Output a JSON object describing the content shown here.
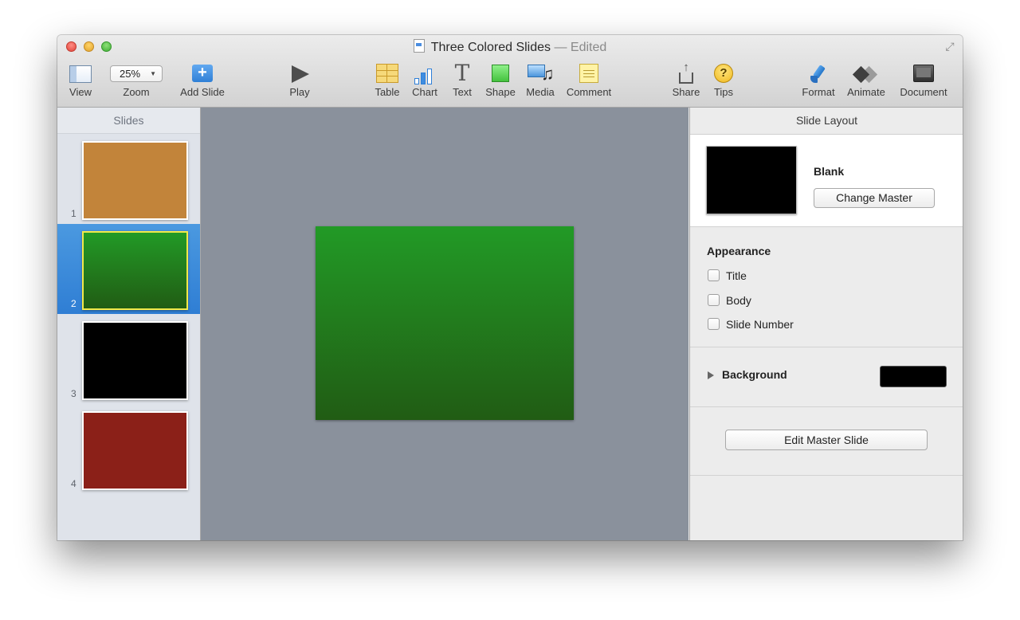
{
  "window": {
    "title": "Three Colored Slides",
    "edited_label": "— Edited"
  },
  "toolbar": {
    "view": {
      "label": "View",
      "icon": "view-icon"
    },
    "zoom": {
      "label": "Zoom",
      "value": "25%",
      "icon": "zoom-popup"
    },
    "add_slide": {
      "label": "Add Slide",
      "icon": "plus-icon"
    },
    "play": {
      "label": "Play",
      "icon": "play-icon"
    },
    "table": {
      "label": "Table",
      "icon": "table-icon"
    },
    "chart": {
      "label": "Chart",
      "icon": "chart-icon"
    },
    "text": {
      "label": "Text",
      "icon": "text-icon",
      "glyph": "T"
    },
    "shape": {
      "label": "Shape",
      "icon": "shape-icon"
    },
    "media": {
      "label": "Media",
      "icon": "media-icon"
    },
    "comment": {
      "label": "Comment",
      "icon": "comment-icon"
    },
    "share": {
      "label": "Share",
      "icon": "share-icon"
    },
    "tips": {
      "label": "Tips",
      "icon": "tips-icon",
      "glyph": "?"
    },
    "format": {
      "label": "Format",
      "icon": "paintbrush-icon"
    },
    "animate": {
      "label": "Animate",
      "icon": "animate-icon"
    },
    "document": {
      "label": "Document",
      "icon": "document-icon"
    }
  },
  "sidebar": {
    "header": "Slides",
    "slides": [
      {
        "number": "1",
        "color": "#c2843a",
        "selected": false
      },
      {
        "number": "2",
        "color": "#21862a",
        "selected": true
      },
      {
        "number": "3",
        "color": "#000000",
        "selected": false
      },
      {
        "number": "4",
        "color": "#8b2018",
        "selected": false
      }
    ]
  },
  "canvas": {
    "slide_color_top": "#229a26",
    "slide_color_bottom": "#215c14"
  },
  "inspector": {
    "header": "Slide Layout",
    "master_name": "Blank",
    "change_master_label": "Change Master",
    "appearance_title": "Appearance",
    "checkboxes": [
      {
        "label": "Title",
        "checked": false
      },
      {
        "label": "Body",
        "checked": false
      },
      {
        "label": "Slide Number",
        "checked": false
      }
    ],
    "background_label": "Background",
    "background_color": "#000000",
    "edit_master_label": "Edit Master Slide"
  }
}
